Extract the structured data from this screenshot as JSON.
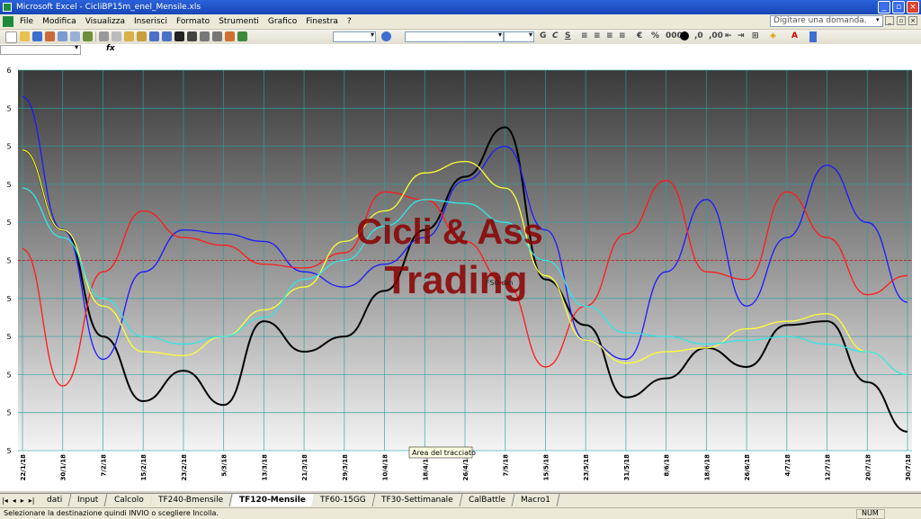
{
  "window": {
    "title": "Microsoft Excel - CicliBP15m_enel_Mensile.xls"
  },
  "menu": {
    "items": [
      "File",
      "Modifica",
      "Visualizza",
      "Inserisci",
      "Formato",
      "Strumenti",
      "Grafico",
      "Finestra",
      "?"
    ],
    "ask_placeholder": "Digitare una domanda."
  },
  "chart": {
    "watermark_line1": "Cicli & Ass",
    "watermark_line2": "Trading",
    "series_label": "FS0-dm",
    "tooltip": "Area del tracciato",
    "y_tick_labels": [
      "6",
      "5",
      "5",
      "5",
      "5",
      "5",
      "5",
      "5",
      "5",
      "5",
      "5"
    ],
    "x_tick_labels": [
      "22/1/18",
      "30/1/18",
      "7/2/18",
      "15/2/18",
      "23/2/18",
      "5/3/18",
      "13/3/18",
      "21/3/18",
      "29/3/18",
      "10/4/18",
      "18/4/18",
      "26/4/18",
      "7/5/18",
      "15/5/18",
      "23/5/18",
      "31/5/18",
      "8/6/18",
      "18/6/18",
      "26/6/18",
      "4/7/18",
      "12/7/18",
      "20/7/18",
      "30/7/18"
    ],
    "colors": {
      "black": "#000000",
      "blue": "#1a1aff",
      "red": "#ff1a1a",
      "yellow": "#ffff33",
      "cyan": "#33e5e5",
      "dotted": "#3c3cff",
      "ref": "#d42020",
      "watermark": "#8b0000"
    }
  },
  "sheet_tabs": {
    "tabs": [
      "dati",
      "Input",
      "Calcolo",
      "TF240-Bmensile",
      "TF120-Mensile",
      "TF60-15GG",
      "TF30-Settimanale",
      "CalBattle",
      "Macro1"
    ],
    "active": "TF120-Mensile"
  },
  "status": {
    "message": "Selezionare la destinazione quindi INVIO o scegliere Incolla.",
    "num": "NUM"
  },
  "chart_data": {
    "type": "line",
    "x": [
      "22/1/18",
      "30/1/18",
      "7/2/18",
      "15/2/18",
      "23/2/18",
      "5/3/18",
      "13/3/18",
      "21/3/18",
      "29/3/18",
      "10/4/18",
      "18/4/18",
      "26/4/18",
      "7/5/18",
      "15/5/18",
      "23/5/18",
      "31/5/18",
      "8/6/18",
      "18/6/18",
      "26/6/18",
      "4/7/18",
      "12/7/18",
      "20/7/18",
      "30/7/18"
    ],
    "series": [
      {
        "values": [
          0.79,
          0.58,
          0.3,
          0.13,
          0.21,
          0.12,
          0.34,
          0.26,
          0.3,
          0.42,
          0.58,
          0.72,
          0.85,
          0.45,
          0.33,
          0.14,
          0.19,
          0.27,
          0.22,
          0.33,
          0.34,
          0.18,
          0.05
        ]
      },
      {
        "values": [
          0.93,
          0.58,
          0.24,
          0.47,
          0.58,
          0.57,
          0.55,
          0.47,
          0.43,
          0.49,
          0.56,
          0.71,
          0.8,
          0.58,
          0.29,
          0.24,
          0.47,
          0.66,
          0.38,
          0.56,
          0.75,
          0.6,
          0.39
        ]
      },
      {
        "values": [
          0.53,
          0.17,
          0.47,
          0.63,
          0.56,
          0.54,
          0.49,
          0.48,
          0.52,
          0.68,
          0.66,
          0.55,
          0.44,
          0.22,
          0.38,
          0.57,
          0.71,
          0.47,
          0.45,
          0.68,
          0.56,
          0.41,
          0.46
        ]
      },
      {
        "values": [
          0.79,
          0.58,
          0.38,
          0.26,
          0.25,
          0.3,
          0.37,
          0.43,
          0.55,
          0.63,
          0.73,
          0.76,
          0.69,
          0.46,
          0.29,
          0.23,
          0.26,
          0.27,
          0.32,
          0.34,
          0.36,
          0.26,
          0.2
        ]
      },
      {
        "values": [
          0.69,
          0.56,
          0.4,
          0.3,
          0.28,
          0.3,
          0.35,
          0.45,
          0.5,
          0.59,
          0.66,
          0.65,
          0.6,
          0.5,
          0.38,
          0.31,
          0.3,
          0.28,
          0.29,
          0.3,
          0.28,
          0.26,
          0.2
        ]
      }
    ],
    "reference_level": 0.5,
    "grid": true,
    "ylim": [
      0,
      1
    ]
  }
}
